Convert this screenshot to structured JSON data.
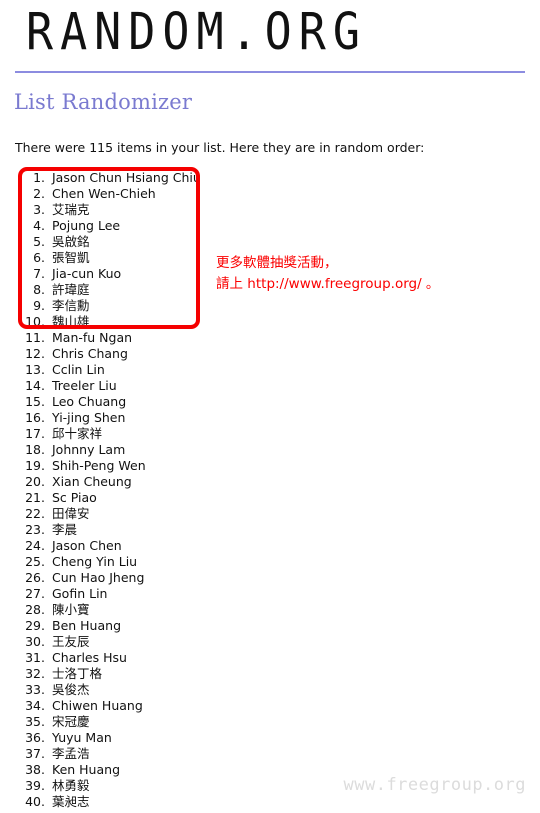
{
  "site": {
    "logo_text": "RANDOM.ORG"
  },
  "page": {
    "title": "List Randomizer",
    "intro": "There were 115 items in your list. Here they are in random order:"
  },
  "colors": {
    "header_rule": "#8c8ce0",
    "page_title": "#7a7ad0",
    "highlight_box_border": "#f50000",
    "annotation_text": "#fb0000",
    "watermark": "#dcdcdc",
    "body_text": "#111111"
  },
  "results": {
    "item_count": 115,
    "items": [
      {
        "n": "1.",
        "name": "Jason Chun Hsiang Chiu"
      },
      {
        "n": "2.",
        "name": "Chen Wen-Chieh"
      },
      {
        "n": "3.",
        "name": "艾瑞克"
      },
      {
        "n": "4.",
        "name": "Pojung Lee"
      },
      {
        "n": "5.",
        "name": "吳啟銘"
      },
      {
        "n": "6.",
        "name": "張智凱"
      },
      {
        "n": "7.",
        "name": "Jia-cun Kuo"
      },
      {
        "n": "8.",
        "name": "許瑋庭"
      },
      {
        "n": "9.",
        "name": "李信勳"
      },
      {
        "n": "10.",
        "name": "魏山雄"
      },
      {
        "n": "11.",
        "name": "Man-fu Ngan"
      },
      {
        "n": "12.",
        "name": "Chris Chang"
      },
      {
        "n": "13.",
        "name": "Cclin Lin"
      },
      {
        "n": "14.",
        "name": "Treeler Liu"
      },
      {
        "n": "15.",
        "name": "Leo Chuang"
      },
      {
        "n": "16.",
        "name": "Yi-jing Shen"
      },
      {
        "n": "17.",
        "name": "邱十家祥"
      },
      {
        "n": "18.",
        "name": "Johnny Lam"
      },
      {
        "n": "19.",
        "name": "Shih-Peng Wen"
      },
      {
        "n": "20.",
        "name": "Xian Cheung"
      },
      {
        "n": "21.",
        "name": "Sc Piao"
      },
      {
        "n": "22.",
        "name": "田偉安"
      },
      {
        "n": "23.",
        "name": "李晨"
      },
      {
        "n": "24.",
        "name": "Jason Chen"
      },
      {
        "n": "25.",
        "name": "Cheng Yin Liu"
      },
      {
        "n": "26.",
        "name": "Cun Hao Jheng"
      },
      {
        "n": "27.",
        "name": "Gofin Lin"
      },
      {
        "n": "28.",
        "name": "陳小寶"
      },
      {
        "n": "29.",
        "name": "Ben Huang"
      },
      {
        "n": "30.",
        "name": "王友辰"
      },
      {
        "n": "31.",
        "name": "Charles Hsu"
      },
      {
        "n": "32.",
        "name": "士洛丁格"
      },
      {
        "n": "33.",
        "name": "吳俊杰"
      },
      {
        "n": "34.",
        "name": "Chiwen Huang"
      },
      {
        "n": "35.",
        "name": "宋冠慶"
      },
      {
        "n": "36.",
        "name": "Yuyu Man"
      },
      {
        "n": "37.",
        "name": "李孟浩"
      },
      {
        "n": "38.",
        "name": "Ken Huang"
      },
      {
        "n": "39.",
        "name": "林勇毅"
      },
      {
        "n": "40.",
        "name": "葉昶志"
      }
    ]
  },
  "annotation": {
    "line1": "更多軟體抽獎活動，",
    "line2_prefix": "請上 ",
    "line2_url": "http://www.freegroup.org/",
    "line2_suffix": " 。"
  },
  "watermark": {
    "text": "www.freegroup.org"
  }
}
